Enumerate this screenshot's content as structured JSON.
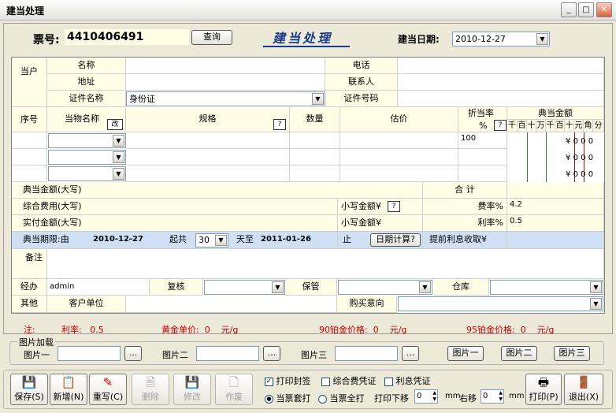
{
  "window": {
    "title": "建当处理",
    "min": "_",
    "max": "□",
    "close": "✕"
  },
  "header": {
    "ticket_label": "票号:",
    "ticket_no": "4410406491",
    "query": "查询",
    "banner": "建当处理",
    "date_label": "建当日期:",
    "date": "2010-12-27"
  },
  "owner": {
    "side": "当户",
    "name": "名称",
    "phone": "电话",
    "address": "地址",
    "contact": "联系人",
    "idtype": "证件名称",
    "idtype_value": "身份证",
    "idno": "证件号码"
  },
  "items": {
    "seq": "序号",
    "item": "当物名称",
    "change": "改",
    "spec": "规格",
    "q": "?",
    "qty": "数量",
    "appraise": "估价",
    "discount": "折当率",
    "pct": "%",
    "amount": "典当金额",
    "units": [
      "千",
      "百",
      "十",
      "万",
      "千",
      "百",
      "十",
      "元",
      "角",
      "分"
    ],
    "row1_discount": "100",
    "yuan": "¥",
    "zero": "0"
  },
  "totals": {
    "amount_caps": "典当金额(大写)",
    "sum": "合   计",
    "fee_caps": "综合费用(大写)",
    "small_amt": "小写金额¥",
    "fee_rate_label": "费率%",
    "fee_rate": "4.2",
    "actual_caps": "实付金额(大写)",
    "rate_label": "利率%",
    "rate": "0.5"
  },
  "period": {
    "label": "典当期限:由",
    "from": "2010-12-27",
    "total": "起共",
    "days": "30",
    "days_to": "天至",
    "to": "2011-01-26",
    "end": "止",
    "calc": "日期计算?",
    "early": "提前利息收取¥"
  },
  "remark": {
    "label": "备注"
  },
  "staff": {
    "handler": "经办",
    "handler_value": "admin",
    "review": "复核",
    "keeper": "保管",
    "store": "仓库",
    "other": "其他",
    "customer": "客户单位",
    "intent": "购买意向"
  },
  "rates": {
    "note": "注:",
    "rate": "利率:",
    "rate_v": "0.5",
    "gold": "黄金单价:",
    "gold_v": "0",
    "unit": "元/g",
    "pt90": "90铂金价格:",
    "pt90_v": "0",
    "pt95": "95铂金价格:",
    "pt95_v": "0"
  },
  "pictures": {
    "title": "图片加载",
    "p1": "图片一",
    "p2": "图片二",
    "p3": "图片三",
    "browse": "...",
    "b1": "图片一",
    "b2": "图片二",
    "b3": "图片三"
  },
  "toolbar": {
    "save": "保存(S)",
    "new": "新增(N)",
    "rewrite": "重写(C)",
    "delete": "删除",
    "edit": "修改",
    "void": "作废",
    "print": "打印(P)",
    "exit": "退出(X)"
  },
  "options": {
    "seal": "打印封签",
    "fee_cert": "综合费凭证",
    "int_cert": "利息凭证",
    "set_print": "当票套打",
    "full_print": "当票全打",
    "down": "打印下移",
    "down_v": "0",
    "mm": "mm",
    "right": "右移",
    "right_v": "0"
  }
}
